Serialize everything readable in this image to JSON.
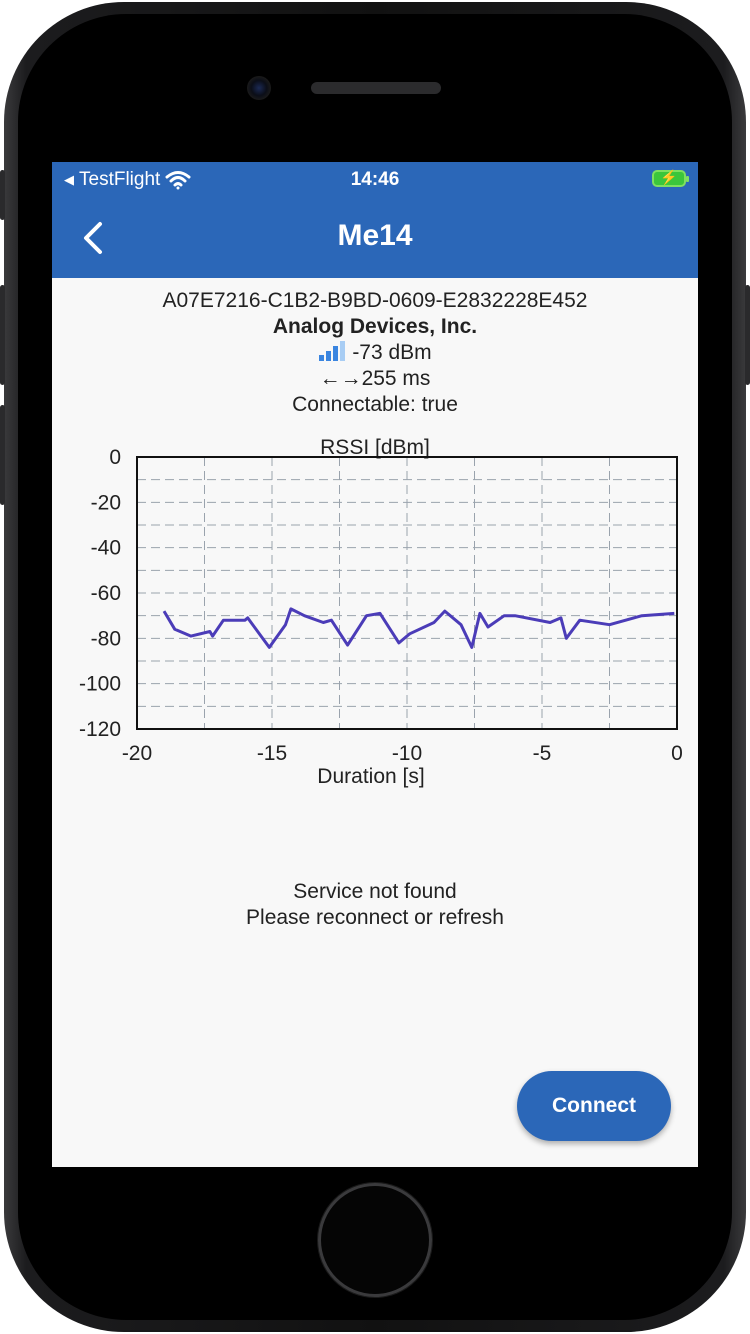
{
  "status_bar": {
    "back_app": "TestFlight",
    "time": "14:46"
  },
  "app_bar": {
    "title": "Me14"
  },
  "device": {
    "uuid": "A07E7216-C1B2-B9BD-0609-E2832228E452",
    "manufacturer": "Analog Devices, Inc.",
    "rssi": "-73 dBm",
    "interval": "255 ms",
    "connectable": "Connectable: true"
  },
  "chart_data": {
    "type": "line",
    "title": "RSSI [dBm]",
    "xlabel": "Duration [s]",
    "ylabel": "",
    "xlim": [
      -20,
      0
    ],
    "ylim": [
      -120,
      0
    ],
    "x_ticks": [
      -20,
      -15,
      -10,
      -5,
      0
    ],
    "y_ticks": [
      0,
      -20,
      -40,
      -60,
      -80,
      -100,
      -120
    ],
    "grid": true,
    "line_color": "#4b3cb8",
    "series": [
      {
        "x": [
          -19.0,
          -18.6,
          -18.0,
          -17.3,
          -17.2,
          -16.8,
          -16.0,
          -15.9,
          -15.1,
          -14.5,
          -14.3,
          -13.8,
          -13.1,
          -12.8,
          -12.2,
          -11.5,
          -11.0,
          -10.3,
          -9.9,
          -9.0,
          -8.6,
          -8.0,
          -7.6,
          -7.3,
          -7.0,
          -6.4,
          -6.0,
          -4.7,
          -4.3,
          -4.1,
          -3.6,
          -2.5,
          -1.3,
          -0.1
        ],
        "y": [
          -68,
          -76,
          -79,
          -77,
          -79,
          -72,
          -72,
          -71,
          -84,
          -74,
          -67,
          -70,
          -73,
          -72,
          -83,
          -70,
          -69,
          -82,
          -78,
          -73,
          -68,
          -74,
          -84,
          -69,
          -75,
          -70,
          -70,
          -73,
          -71,
          -80,
          -72,
          -74,
          -70,
          -69
        ]
      }
    ]
  },
  "messages": {
    "line1": "Service not found",
    "line2": "Please reconnect or refresh"
  },
  "actions": {
    "connect_label": "Connect"
  },
  "colors": {
    "primary": "#2b67b8",
    "background": "#f8f8f8",
    "line": "#4b3cb8"
  },
  "icons": {
    "back": "chevron-left-icon",
    "signal": "signal-bars-icon",
    "interval": "left-right-arrows-icon"
  }
}
